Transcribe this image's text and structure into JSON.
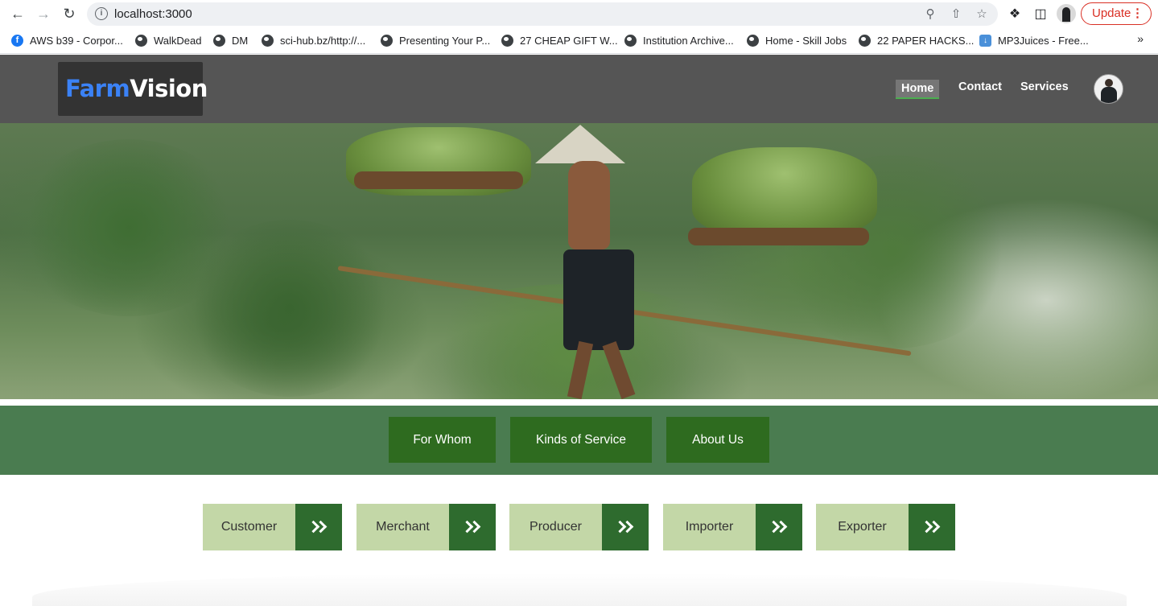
{
  "browser": {
    "url": "localhost:3000",
    "update_label": "Update",
    "bookmarks": [
      {
        "label": "AWS b39 - Corpor...",
        "icon": "facebook-icon"
      },
      {
        "label": "WalkDead",
        "icon": "globe-icon"
      },
      {
        "label": "DM",
        "icon": "globe-icon"
      },
      {
        "label": "sci-hub.bz/http://...",
        "icon": "globe-icon"
      },
      {
        "label": "Presenting Your P...",
        "icon": "globe-icon"
      },
      {
        "label": "27 CHEAP GIFT W...",
        "icon": "globe-icon"
      },
      {
        "label": "Institution Archive...",
        "icon": "globe-icon"
      },
      {
        "label": "Home - Skill Jobs",
        "icon": "globe-icon"
      },
      {
        "label": "22 PAPER HACKS...",
        "icon": "globe-icon"
      },
      {
        "label": "MP3Juices - Free...",
        "icon": "download-icon"
      }
    ],
    "more": "»"
  },
  "site": {
    "logo_part1": "Farm",
    "logo_part2": "Vision",
    "nav": {
      "home": "Home",
      "contact": "Contact",
      "services": "Services"
    }
  },
  "sections": {
    "for_whom": "For Whom",
    "kinds": "Kinds of Service",
    "about": "About Us"
  },
  "roles": [
    {
      "label": "Customer"
    },
    {
      "label": "Merchant"
    },
    {
      "label": "Producer"
    },
    {
      "label": "Importer"
    },
    {
      "label": "Exporter"
    }
  ],
  "colors": {
    "header_bg": "#555555",
    "logo_accent": "#3b82f6",
    "section_bar": "#4a7c50",
    "section_button": "#2e6b1f",
    "role_label_bg": "#c3d7a7",
    "role_arrow_bg": "#2e6b2e"
  }
}
